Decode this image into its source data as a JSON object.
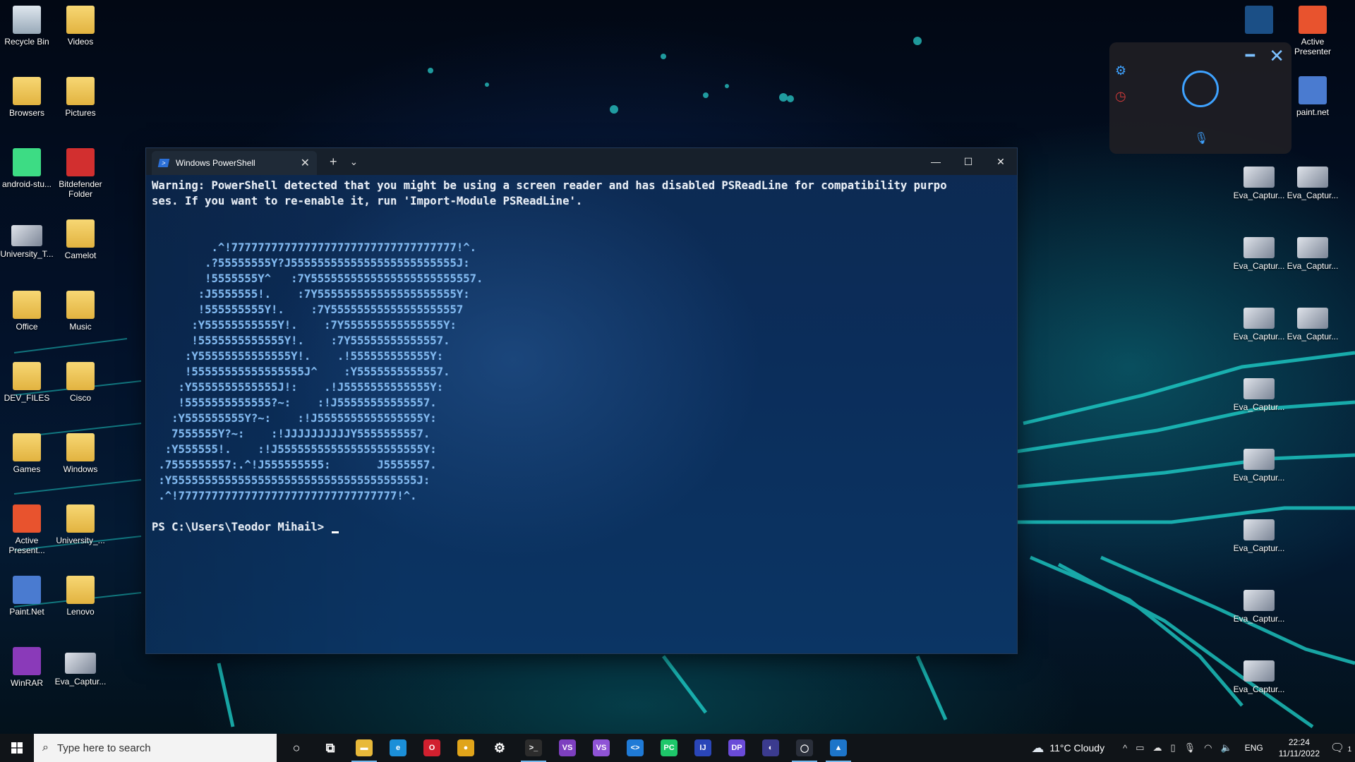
{
  "desktop": {
    "left_icons": [
      {
        "label": "Recycle Bin",
        "type": "bin"
      },
      {
        "label": "Videos",
        "type": "folder"
      },
      {
        "label": "Browsers",
        "type": "folder"
      },
      {
        "label": "Pictures",
        "type": "folder"
      },
      {
        "label": "android-stu...",
        "type": "app",
        "color": "#3ddc84"
      },
      {
        "label": "Bitdefender Folder",
        "type": "app",
        "color": "#d22f2f"
      },
      {
        "label": "University_T...",
        "type": "thumb"
      },
      {
        "label": "Camelot",
        "type": "folder"
      },
      {
        "label": "Office",
        "type": "folder"
      },
      {
        "label": "Music",
        "type": "folder"
      },
      {
        "label": "DEV_FILES",
        "type": "folder"
      },
      {
        "label": "Cisco",
        "type": "folder"
      },
      {
        "label": "Games",
        "type": "folder"
      },
      {
        "label": "Windows",
        "type": "folder"
      },
      {
        "label": "Active Present...",
        "type": "app",
        "color": "#e8532e"
      },
      {
        "label": "University_...",
        "type": "folder"
      },
      {
        "label": "Paint.Net",
        "type": "app",
        "color": "#4a7bd0"
      },
      {
        "label": "Lenovo",
        "type": "folder"
      },
      {
        "label": "WinRAR",
        "type": "app",
        "color": "#8a3ab9"
      },
      {
        "label": "Eva_Captur...",
        "type": "thumb"
      }
    ],
    "right_icons": [
      {
        "label": "",
        "type": "app",
        "color": "#1b4f86"
      },
      {
        "label": "Active Presenter",
        "type": "app",
        "color": "#e8532e"
      },
      {
        "label": "paint.net",
        "type": "app",
        "color": "#4a7bd0"
      },
      {
        "label": "Eva_Captur...",
        "type": "thumb"
      },
      {
        "label": "Eva_Captur...",
        "type": "thumb"
      },
      {
        "label": "Eva_Captur...",
        "type": "thumb"
      },
      {
        "label": "Eva_Captur...",
        "type": "thumb"
      },
      {
        "label": "Eva_Captur...",
        "type": "thumb"
      },
      {
        "label": "Eva_Captur...",
        "type": "thumb"
      },
      {
        "label": "Eva_Captur...",
        "type": "thumb"
      },
      {
        "label": "Eva_Captur...",
        "type": "thumb"
      },
      {
        "label": "Eva_Captur...",
        "type": "thumb"
      },
      {
        "label": "Eva_Captur...",
        "type": "thumb"
      },
      {
        "label": "Eva_Captur...",
        "type": "thumb"
      }
    ]
  },
  "terminal": {
    "tab_title": "Windows PowerShell",
    "new_tab": "+",
    "dropdown": "⌄",
    "minimize": "—",
    "maximize": "☐",
    "close": "✕",
    "warning_line1": "Warning: PowerShell detected that you might be using a screen reader and has disabled PSReadLine for compatibility purpo",
    "warning_line2": "ses. If you want to re-enable it, run 'Import-Module PSReadLine'.",
    "ascii_art": [
      "         .^!7777777777777777777777777777777777!^.",
      "        .?55555555Y?J5555555555555555555555555J:",
      "        !5555555Y^   :7Y5555555555555555555555557.",
      "       :J5555555!.    :7Y555555555555555555555Y:",
      "       !555555555Y!.    :7Y55555555555555555557",
      "      :Y55555555555Y!.    :7Y555555555555555Y:",
      "      !5555555555555Y!.    :7Y55555555555557.",
      "     :Y55555555555555Y!.    .!555555555555Y:",
      "     !55555555555555555J^    :Y5555555555557.",
      "    :Y5555555555555J!:    .!J5555555555555Y:",
      "    !5555555555555?~:    :!J55555555555557.",
      "   :Y555555555Y?~:    :!J5555555555555555Y:",
      "   7555555Y?~:    :!JJJJJJJJJJY5555555557.",
      "  :Y555555!.    :!J5555555555555555555555Y:",
      " .7555555557:.^!J555555555:       J5555557.",
      " :Y5555555555555555555555555555555555555J:",
      " .^!777777777777777777777777777777777!^."
    ],
    "prompt": "PS C:\\Users\\Teodor Mihail> "
  },
  "taskbar": {
    "search_placeholder": "Type here to search",
    "apps": [
      {
        "name": "cortana",
        "glyph": "○",
        "color": "transparent"
      },
      {
        "name": "task-view",
        "glyph": "⧉",
        "color": "transparent"
      },
      {
        "name": "file-explorer",
        "glyph": "▬",
        "color": "#e8b93a"
      },
      {
        "name": "edge",
        "glyph": "e",
        "color": "#1b8fd8"
      },
      {
        "name": "opera",
        "glyph": "O",
        "color": "#d1202f"
      },
      {
        "name": "chrome",
        "glyph": "●",
        "color": "#e0a41a"
      },
      {
        "name": "settings",
        "glyph": "⚙",
        "color": "transparent"
      },
      {
        "name": "terminal",
        "glyph": ">_",
        "color": "#2c2c2c"
      },
      {
        "name": "visual-studio",
        "glyph": "VS",
        "color": "#7d3fbf"
      },
      {
        "name": "visual-studio-2",
        "glyph": "VS",
        "color": "#8f53d6"
      },
      {
        "name": "vs-code",
        "glyph": "<>",
        "color": "#1f7ad6"
      },
      {
        "name": "pycharm",
        "glyph": "PC",
        "color": "#1ec76a"
      },
      {
        "name": "intellij",
        "glyph": "IJ",
        "color": "#2a46b8"
      },
      {
        "name": "dataspell",
        "glyph": "DP",
        "color": "#6a4bd8"
      },
      {
        "name": "eclipse",
        "glyph": "◐",
        "color": "#3b3b8f"
      },
      {
        "name": "active-window",
        "glyph": "◯",
        "color": "#2a2f3a"
      },
      {
        "name": "photos",
        "glyph": "▲",
        "color": "#1d75c9"
      }
    ],
    "weather": "11°C  Cloudy",
    "tray_up": "^",
    "lang": "ENG",
    "time": "22:24",
    "date": "11/11/2022",
    "notifications": "1"
  }
}
